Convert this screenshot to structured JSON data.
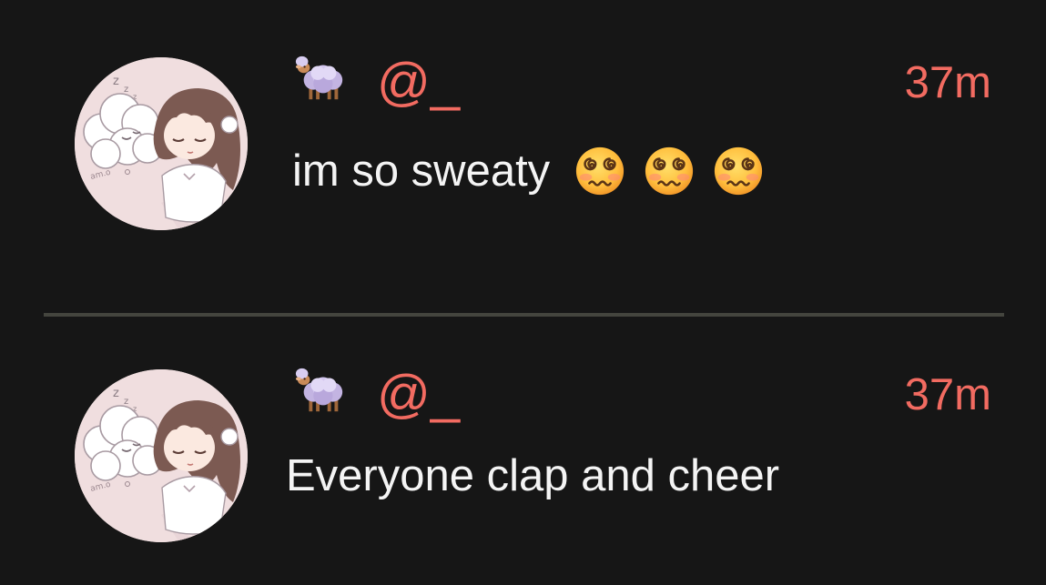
{
  "posts": [
    {
      "handle": "@_",
      "timestamp": "37m",
      "text": "im so sweaty",
      "emojis": [
        "dizzy-face",
        "dizzy-face",
        "dizzy-face"
      ]
    },
    {
      "handle": "@_",
      "timestamp": "37m",
      "text": "Everyone clap and cheer"
    }
  ],
  "icons": {
    "name_emoji": "sheep-icon",
    "avatar": "sleeping-anime-girl-with-sheep-avatar"
  },
  "colors": {
    "background": "#161616",
    "accent": "#f26b61",
    "text": "#f4f4f4",
    "divider": "#44453e"
  }
}
